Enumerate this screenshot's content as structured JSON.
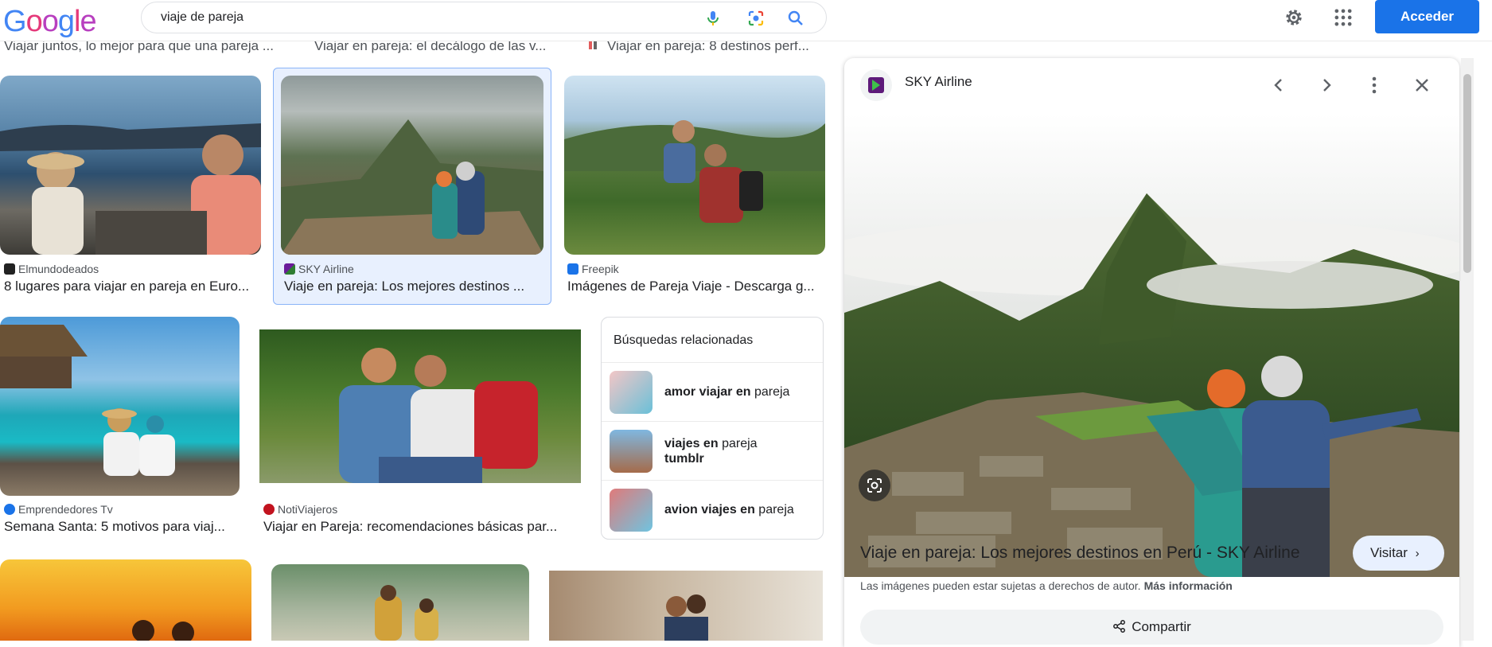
{
  "header": {
    "logo_letters": [
      "G",
      "o",
      "o",
      "g",
      "l",
      "e"
    ],
    "search_query": "viaje de pareja",
    "signin_label": "Acceder"
  },
  "top_captions": [
    "Viajar juntos, lo mejor para que una pareja ...",
    "Viajar en pareja: el decálogo de las v...",
    "Viajar en pareja: 8 destinos perf..."
  ],
  "results": [
    {
      "source": "Elmundodeados",
      "title": "8 lugares para viajar en pareja en Euro..."
    },
    {
      "source": "SKY Airline",
      "title": "Viaje en pareja: Los mejores destinos ..."
    },
    {
      "source": "Freepik",
      "title": "Imágenes de Pareja Viaje - Descarga g..."
    },
    {
      "source": "Emprendedores Tv",
      "title": "Semana Santa: 5 motivos para viaj..."
    },
    {
      "source": "NotiViajeros",
      "title": "Viajar en Pareja: recomendaciones básicas par..."
    }
  ],
  "related": {
    "title": "Búsquedas relacionadas",
    "items": [
      {
        "bold": "amor viajar en",
        "rest": "pareja"
      },
      {
        "bold": "viajes en",
        "rest": "pareja",
        "bold2": "tumblr"
      },
      {
        "bold": "avion viajes en",
        "rest": "pareja"
      }
    ]
  },
  "preview": {
    "source": "SKY Airline",
    "title": "Viaje en pareja: Los mejores destinos en Perú - SKY Airline",
    "visit_label": "Visitar",
    "copyright_text": "Las imágenes pueden estar sujetas a derechos de autor.",
    "more_info_label": "Más información",
    "share_label": "Compartir"
  },
  "colors": {
    "accent": "#1a73e8",
    "selected_bg": "#e8f0fe"
  }
}
